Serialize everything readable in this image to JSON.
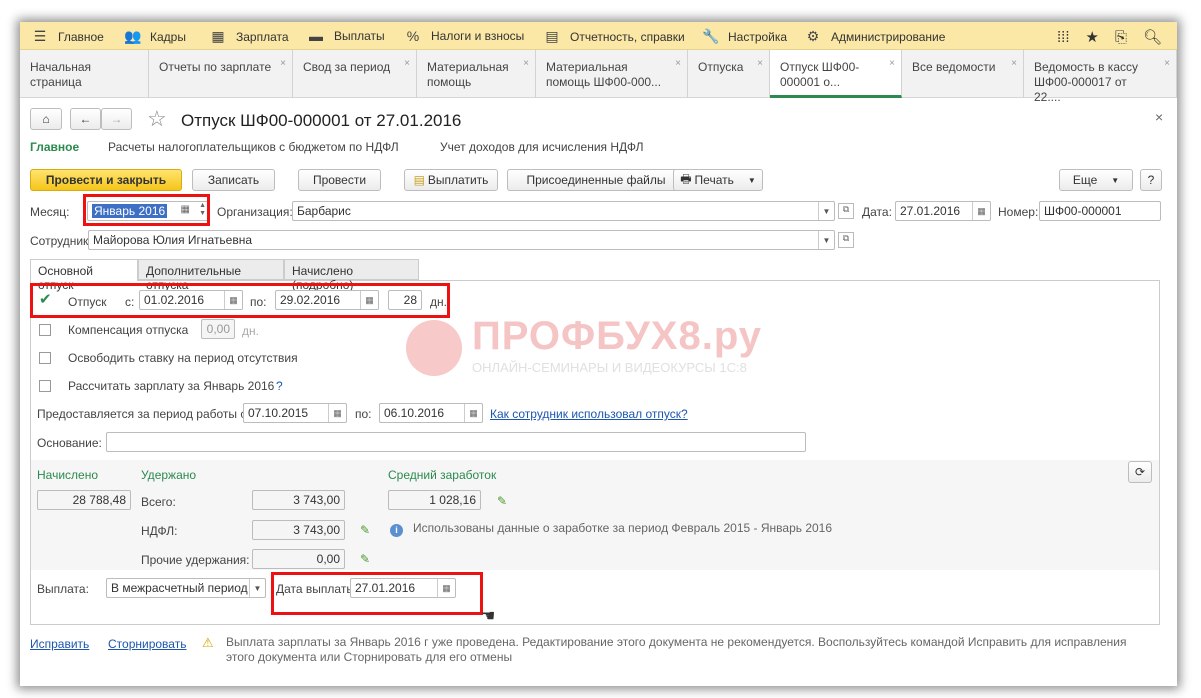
{
  "sections": [
    {
      "icon": "menu-icon",
      "label": "Главное"
    },
    {
      "icon": "people-icon",
      "label": "Кадры"
    },
    {
      "icon": "calculator-icon",
      "label": "Зарплата"
    },
    {
      "icon": "wallet-icon",
      "label": "Выплаты"
    },
    {
      "icon": "percent-icon",
      "label": "Налоги и взносы"
    },
    {
      "icon": "report-icon",
      "label": "Отчетность, справки"
    },
    {
      "icon": "wrench-icon",
      "label": "Настройка"
    },
    {
      "icon": "gear-icon",
      "label": "Администрирование"
    }
  ],
  "open_tabs": [
    {
      "label": "Начальная страница"
    },
    {
      "label": "Отчеты по зарплате"
    },
    {
      "label": "Свод за период"
    },
    {
      "label": "Материальная помощь"
    },
    {
      "label": "Материальная помощь ШФ00-000..."
    },
    {
      "label": "Отпуска"
    },
    {
      "label": "Отпуск ШФ00-000001 о...",
      "active": true
    },
    {
      "label": "Все ведомости"
    },
    {
      "label": "Ведомость в кассу ШФ00-000017 от 22...."
    }
  ],
  "doc": {
    "title": "Отпуск ШФ00-000001 от 27.01.2016"
  },
  "sublinks": [
    "Главное",
    "Расчеты налогоплательщиков с бюджетом по НДФЛ",
    "Учет доходов для исчисления НДФЛ"
  ],
  "toolbar": {
    "post_close": "Провести и закрыть",
    "save": "Записать",
    "post": "Провести",
    "pay": "Выплатить",
    "files": "Присоединенные файлы",
    "print": "Печать",
    "more": "Еще",
    "help": "?"
  },
  "header": {
    "month_label": "Месяц:",
    "month": "Январь 2016",
    "org_label": "Организация:",
    "org": "Барбарис",
    "date_label": "Дата:",
    "date": "27.01.2016",
    "number_label": "Номер:",
    "number": "ШФ00-000001",
    "employee_label": "Сотрудник:",
    "employee": "Майорова Юлия Игнатьевна"
  },
  "inner_tabs": [
    "Основной отпуск",
    "Дополнительные отпуска",
    "Начислено (подробно)"
  ],
  "leave": {
    "label": "Отпуск",
    "from_label": "с:",
    "from": "01.02.2016",
    "to_label": "по:",
    "to": "29.02.2016",
    "days": "28",
    "days_unit": "дн.",
    "checked": true
  },
  "compensation": {
    "label": "Компенсация отпуска",
    "value": "0,00",
    "unit": "дн."
  },
  "free_rate": "Освободить ставку на период отсутствия",
  "calc_salary": {
    "label": "Рассчитать зарплату за Январь 2016",
    "help": "?"
  },
  "period": {
    "label": "Предоставляется за период работы с:",
    "from": "07.10.2015",
    "to_label": "по:",
    "to": "06.10.2016",
    "link": "Как сотрудник использовал отпуск?"
  },
  "basis": {
    "label": "Основание:",
    "value": ""
  },
  "totals": {
    "accrued_label": "Начислено",
    "accrued": "28 788,48",
    "withheld_label": "Удержано",
    "total_label": "Всего:",
    "total": "3 743,00",
    "ndfl_label": "НДФЛ:",
    "ndfl": "3 743,00",
    "other_label": "Прочие удержания:",
    "other": "0,00",
    "avg_label": "Средний заработок",
    "avg": "1 028,16",
    "info": "Использованы данные о заработке за период Февраль 2015 - Январь 2016"
  },
  "payment": {
    "label": "Выплата:",
    "value": "В межрасчетный период",
    "date_label": "Дата выплаты:",
    "date": "27.01.2016"
  },
  "footer": {
    "fix": "Исправить",
    "reverse": "Сторнировать",
    "warning": "Выплата зарплаты за Январь 2016 г уже проведена. Редактирование этого документа не рекомендуется. Воспользуйтесь командой Исправить для исправления этого документа или Сторнировать для его отмены"
  },
  "watermark": {
    "brand": "ПРОФБУХ8.ру",
    "tagline": "ОНЛАЙН-СЕМИНАРЫ И ВИДЕОКУРСЫ 1С:8"
  }
}
